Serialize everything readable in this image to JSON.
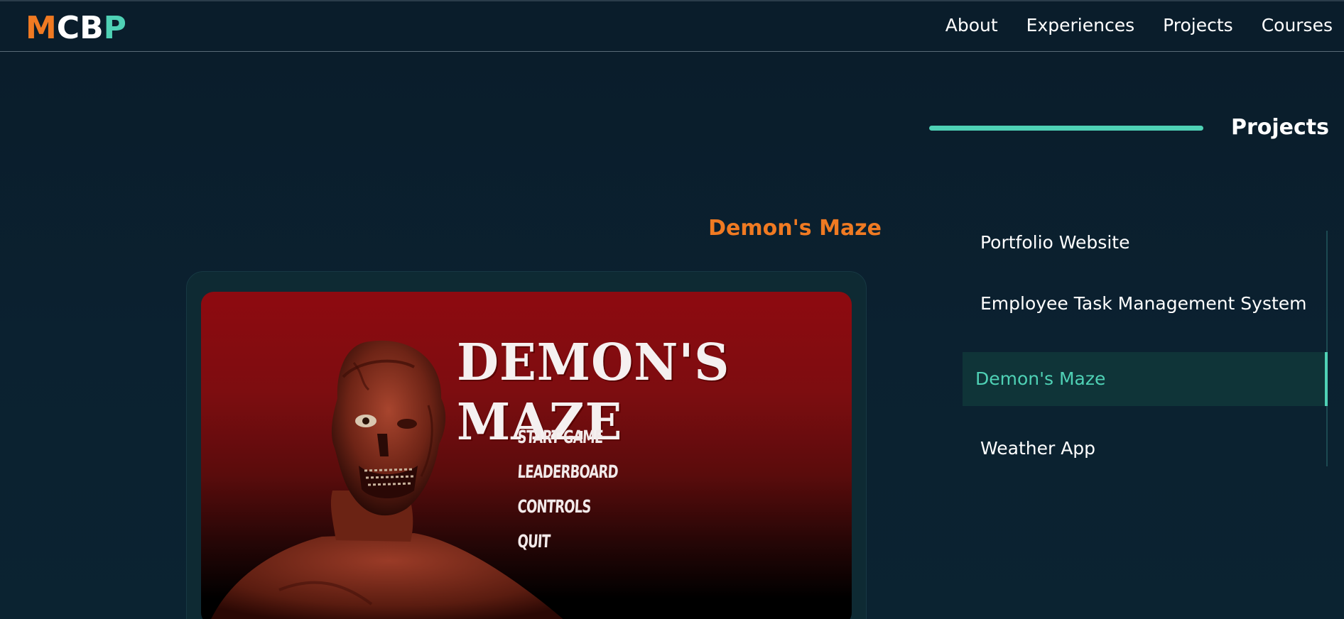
{
  "logo": {
    "letters": [
      "M",
      "C",
      "B",
      "P"
    ],
    "colors": [
      "#f07a22",
      "#ffffff",
      "#ffffff",
      "#4fd1b5"
    ]
  },
  "nav": {
    "items": [
      "About",
      "Experiences",
      "Projects",
      "Courses"
    ]
  },
  "section": {
    "title": "Projects",
    "accent_color": "#4fd1b5"
  },
  "project": {
    "title": "Demon's Maze",
    "title_color": "#f07a22",
    "preview": {
      "game_title": "DEMON'S MAZE",
      "menu": [
        "START GAME",
        "LEADERBOARD",
        "CONTROLS",
        "QUIT"
      ]
    }
  },
  "projects_list": {
    "items": [
      {
        "label": "Portfolio Website"
      },
      {
        "label": "Employee Task Management System"
      },
      {
        "label": "Demon's Maze",
        "active": true
      },
      {
        "label": "Weather App"
      }
    ],
    "active_color": "#4fd1b5"
  }
}
